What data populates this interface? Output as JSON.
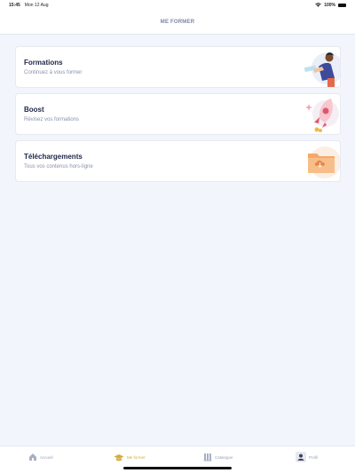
{
  "status_bar": {
    "time": "15:45",
    "date": "Mon 12 Aug",
    "battery": "100%",
    "icons": [
      "wifi-icon",
      "battery-icon"
    ]
  },
  "header": {
    "title": "ME FORMER"
  },
  "cards": [
    {
      "title": "Formations",
      "subtitle": "Continuez à vous former",
      "icon": "person-reading-illustration"
    },
    {
      "title": "Boost",
      "subtitle": "Révisez vos formations",
      "icon": "rocket-illustration"
    },
    {
      "title": "Téléchargements",
      "subtitle": "Tous vos contenus hors-ligne",
      "icon": "download-folder-illustration"
    }
  ],
  "tabbar": {
    "items": [
      {
        "label": "Accueil",
        "icon": "home-icon",
        "active": false
      },
      {
        "label": "Me former",
        "icon": "graduation-cap-icon",
        "active": true
      },
      {
        "label": "Catalogue",
        "icon": "library-icon",
        "active": false
      },
      {
        "label": "Profil",
        "icon": "profile-icon",
        "active": false
      }
    ]
  },
  "colors": {
    "background": "#f2f5fb",
    "active_tab": "#d2ad39",
    "inactive_tab": "#9aa2b8",
    "title_text": "#1f2547",
    "subtitle_text": "#8a91ad"
  }
}
